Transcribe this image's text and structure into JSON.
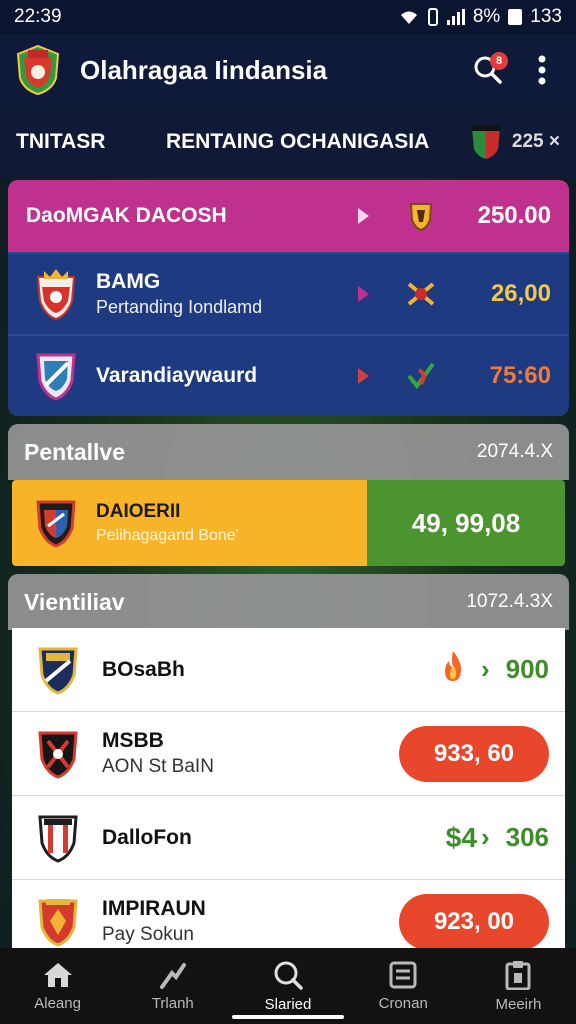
{
  "status": {
    "time": "22:39",
    "right": "8% ",
    "battery": "133"
  },
  "app": {
    "title": "Olahragaa Iindansia",
    "notif_count": "8"
  },
  "tabs": {
    "tab1": "TNITASR",
    "tab2": "RENTAING OCHANIGASIA",
    "count": "225 ×"
  },
  "featured": {
    "header": {
      "title": "DaoMGAK DACOSH",
      "value": "250.00"
    },
    "rows": [
      {
        "name": "BAMG",
        "sub": "Pertanding Iondlamd",
        "value": "26,00"
      },
      {
        "name": "Varandiaywaurd",
        "sub": "",
        "value": "75:60"
      }
    ]
  },
  "section1": {
    "title": "Pentallve",
    "count": "2074.4.X"
  },
  "highlight": {
    "name": "DAIOERII",
    "sub": "Pelihagagand Bone'",
    "value": "49, 99,08"
  },
  "section2": {
    "title": "Vientiliav",
    "count": "1072.4.3X"
  },
  "list": [
    {
      "name": "BOsaBh",
      "sub": "",
      "value": "900",
      "icon": "flame-icon"
    },
    {
      "name": "MSBB",
      "sub": "AON St BaIN",
      "value": "933, 60"
    },
    {
      "name": "DalloFon",
      "sub": "",
      "value": "306",
      "prefix": "$4"
    },
    {
      "name": "IMPIRAUN",
      "sub": "Pay Sokun",
      "value": "923, 00"
    }
  ],
  "nav": [
    {
      "label": "Aleang",
      "icon": "home-icon"
    },
    {
      "label": "Trlanh",
      "icon": "trend-icon"
    },
    {
      "label": "Slaried",
      "icon": "search-icon"
    },
    {
      "label": "Cronan",
      "icon": "calendar-icon"
    },
    {
      "label": "Meeirh",
      "icon": "clipboard-icon"
    }
  ],
  "colors": {
    "pink": "#c0318f",
    "navy": "#1e3a80",
    "gold": "#f7b429",
    "green": "#4c9430",
    "red": "#e9472b"
  }
}
